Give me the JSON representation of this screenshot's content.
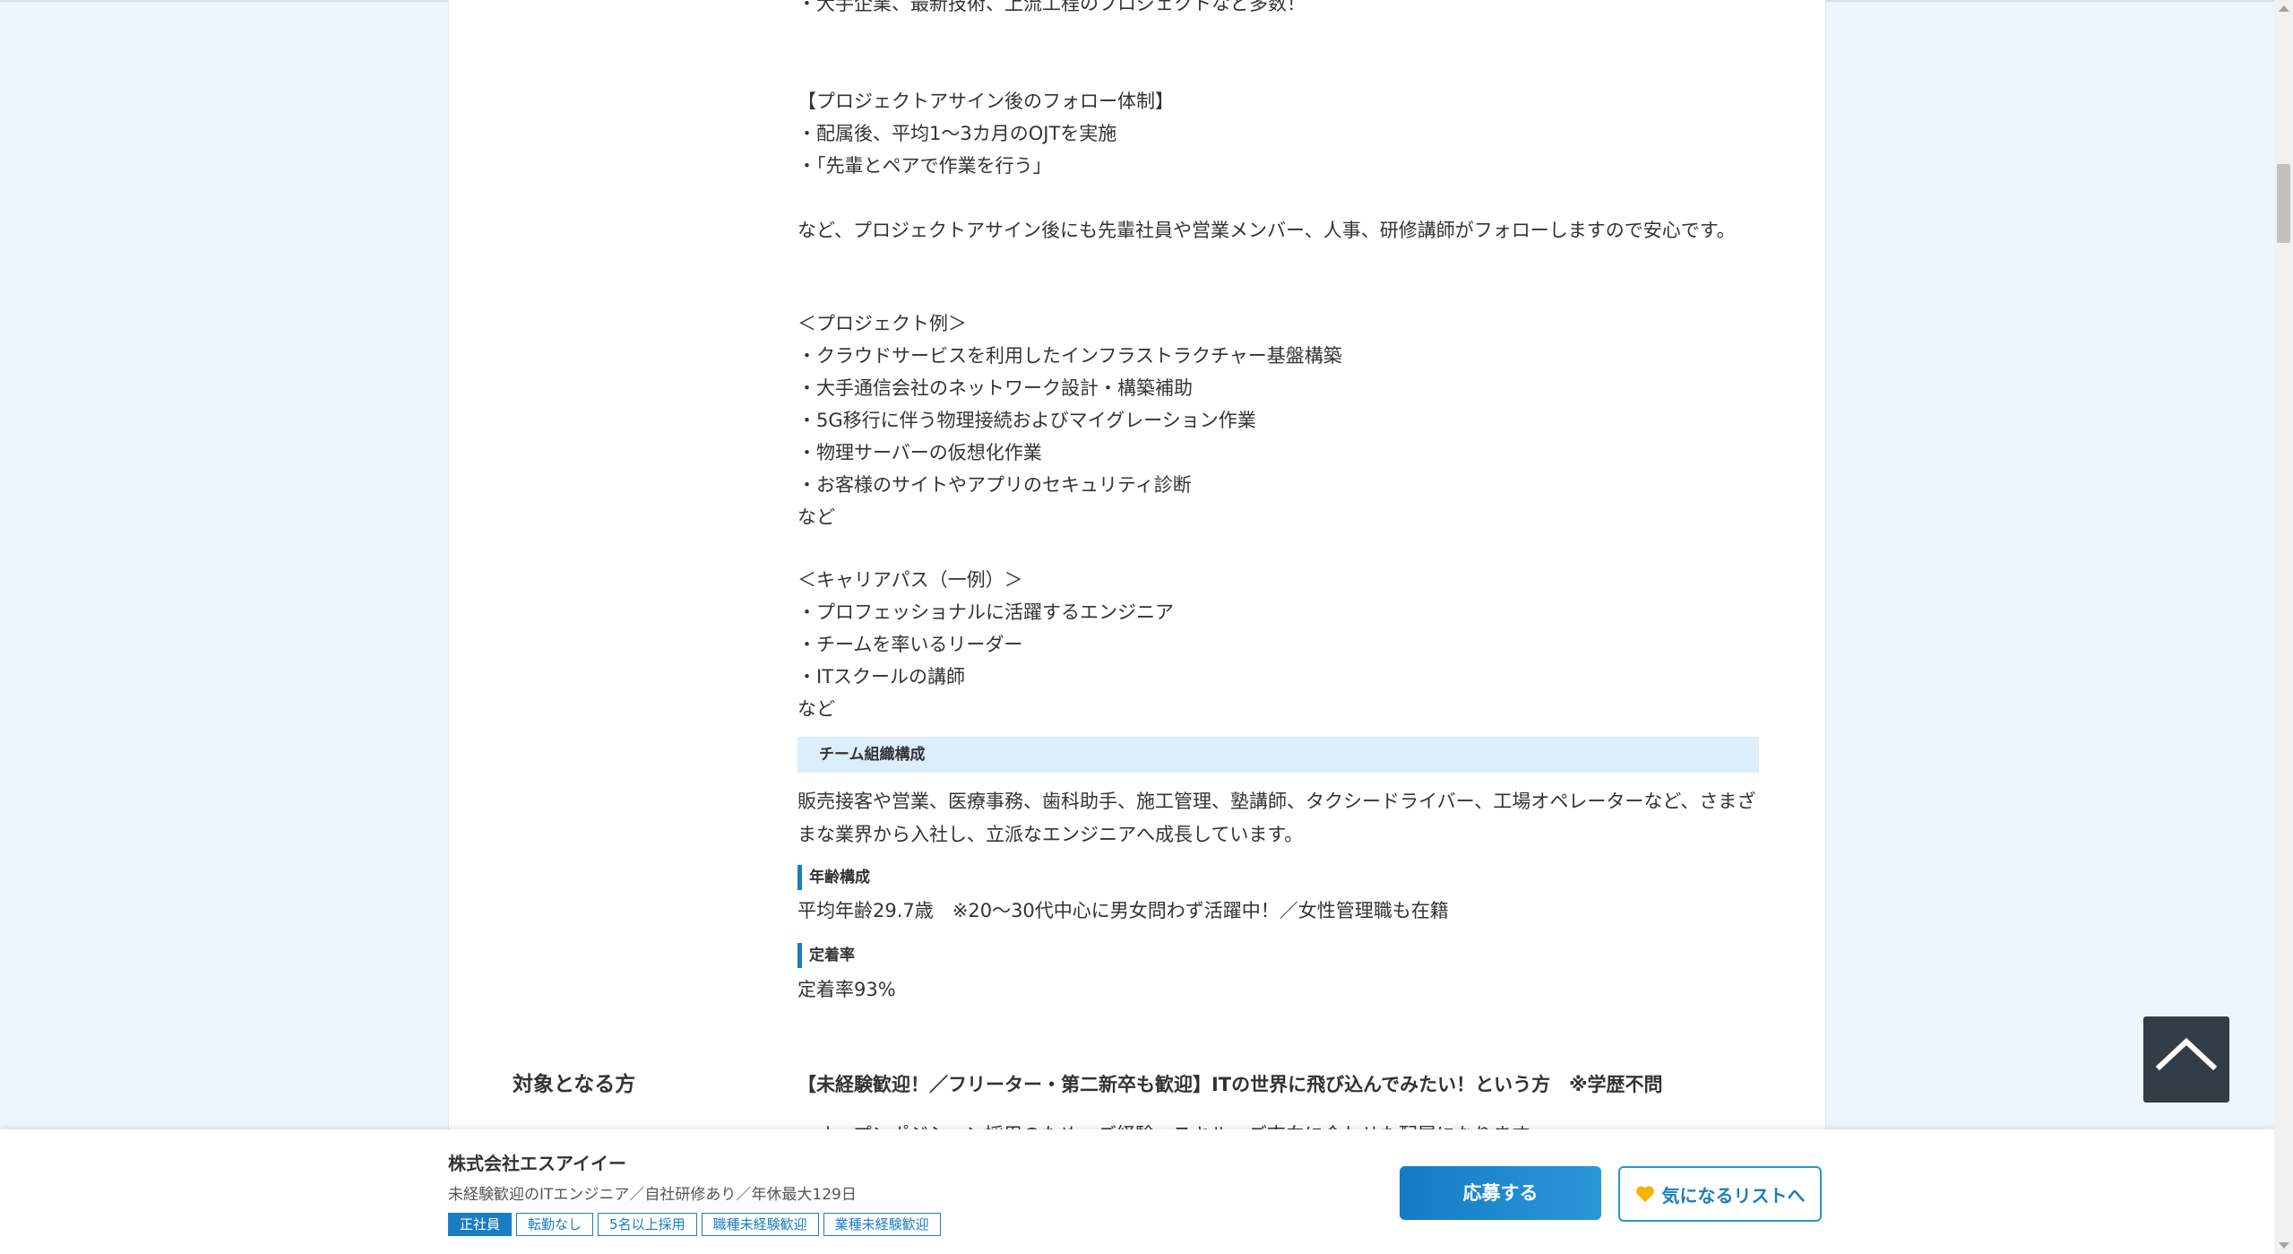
{
  "description": {
    "partial_top_line": "・大手企業、最新技術、上流工程のプロジェクトなど多数！",
    "follow_title": "【プロジェクトアサイン後のフォロー体制】",
    "follow_items": [
      "・配属後、平均1～3カ月のOJTを実施",
      "・「先輩とペアで作業を行う」"
    ],
    "follow_note": "など、プロジェクトアサイン後にも先輩社員や営業メンバー、人事、研修講師がフォローしますので安心です。",
    "project_title": "＜プロジェクト例＞",
    "project_items": [
      "・クラウドサービスを利用したインフラストラクチャー基盤構築",
      "・大手通信会社のネットワーク設計・構築補助",
      "・5G移行に伴う物理接続およびマイグレーション作業",
      "・物理サーバーの仮想化作業",
      "・お客様のサイトやアプリのセキュリティ診断"
    ],
    "project_end": "など",
    "career_title": "＜キャリアパス（一例）＞",
    "career_items": [
      "・プロフェッショナルに活躍するエンジニア",
      "・チームを率いるリーダー",
      "・ITスクールの講師"
    ],
    "career_end": "など"
  },
  "team": {
    "heading": "チーム組織構成",
    "text": "販売接客や営業、医療事務、歯科助手、施工管理、塾講師、タクシードライバー、工場オペレーターなど、さまざまな業界から入社し、立派なエンジニアへ成長しています。",
    "age_label": "年齢構成",
    "age_text": "平均年齢29.7歳　※20～30代中心に男女問わず活躍中！／女性管理職も在籍",
    "retention_label": "定着率",
    "retention_text": "定着率93%"
  },
  "target": {
    "label": "対象となる方",
    "headline": "【未経験歓迎！／フリーター・第二新卒も歓迎】ITの世界に飛び込んでみたい！という方　※学歴不問",
    "cut_line": "・オープンポジション採用のため、ご経験・スキル・ご志向に合わせた配属になります。"
  },
  "bottom_bar": {
    "company": "株式会社エスアイイー",
    "job_title": "未経験歓迎のITエンジニア／自社研修あり／年休最大129日",
    "tags": [
      "正社員",
      "転勤なし",
      "5名以上採用",
      "職種未経験歓迎",
      "業種未経験歓迎"
    ],
    "apply_label": "応募する",
    "favorite_label": "気になるリストへ"
  },
  "colors": {
    "accent": "#1a7dc2",
    "section_bg": "#dceefb",
    "page_bg": "#eef6fd",
    "to_top_bg": "#333d45"
  },
  "icons": {
    "to_top": "chevron-up-icon",
    "favorite": "heart-icon"
  }
}
